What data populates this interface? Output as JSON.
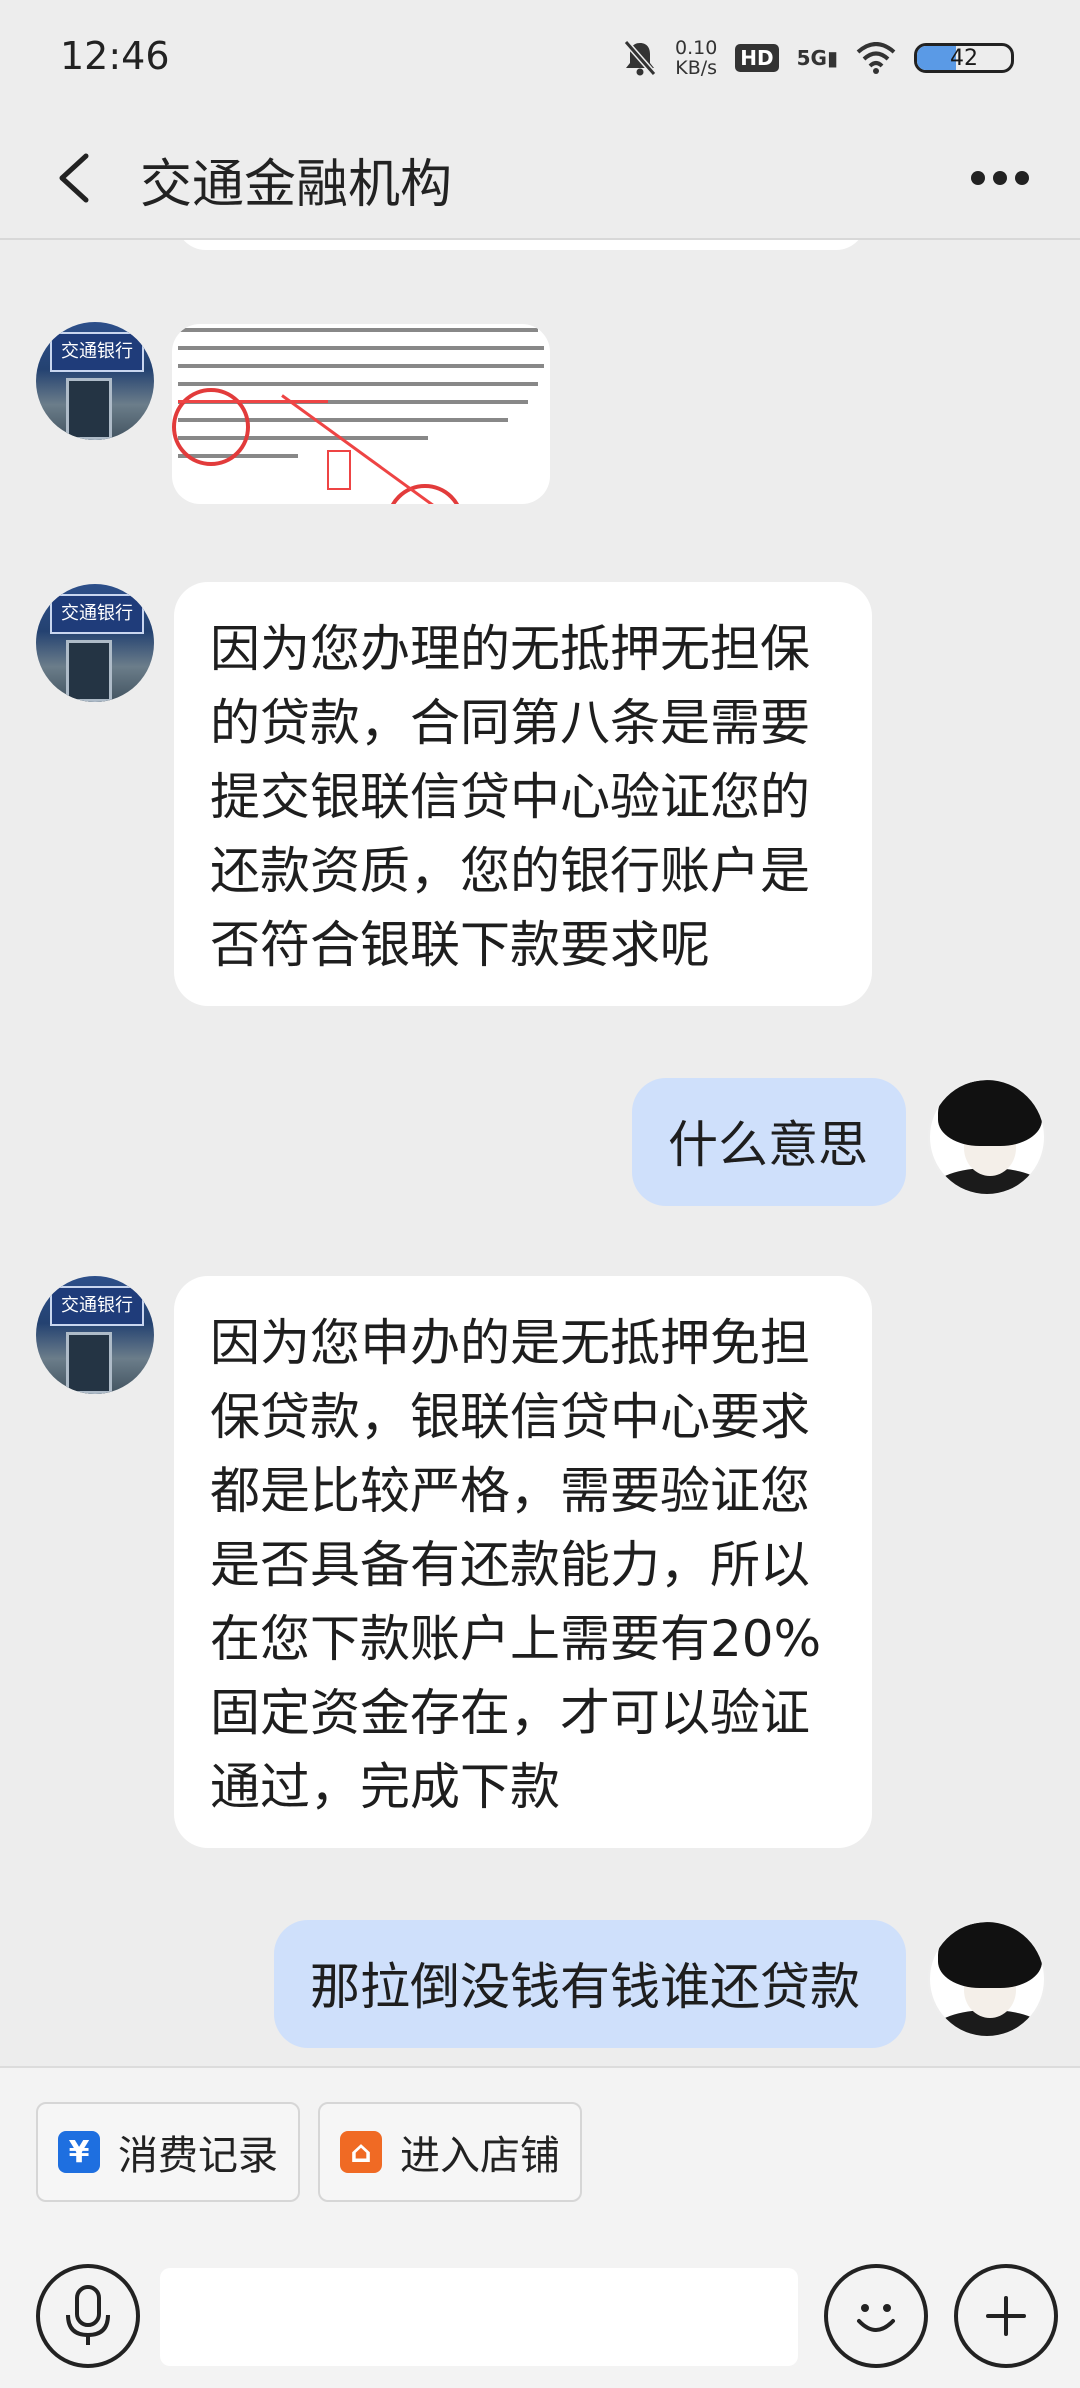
{
  "status": {
    "time": "12:46",
    "net_speed": "0.10",
    "net_unit": "KB/s",
    "hd": "HD",
    "signal": "5G",
    "battery": "42",
    "battery_level": 0.42
  },
  "header": {
    "title": "交通金融机构"
  },
  "avatars": {
    "bank_sign": "交通银行"
  },
  "messages": [
    {
      "side": "in",
      "type": "image"
    },
    {
      "side": "in",
      "text": "因为您办理的无抵押无担保的贷款，合同第八条是需要提交银联信贷中心验证您的还款资质，您的银行账户是否符合银联下款要求呢"
    },
    {
      "side": "out",
      "text": "什么意思"
    },
    {
      "side": "in",
      "text": "因为您申办的是无抵押免担保贷款，银联信贷中心要求都是比较严格，需要验证您是否具备有还款能力，所以在您下款账户上需要有20%固定资金存在，才可以验证通过，完成下款"
    },
    {
      "side": "out",
      "text": "那拉倒没钱有钱谁还贷款"
    }
  ],
  "quick_actions": [
    {
      "label": "消费记录",
      "icon": "yen-icon",
      "glyph": "¥",
      "color": "#1e6fe0"
    },
    {
      "label": "进入店铺",
      "icon": "shop-icon",
      "glyph": "⌂",
      "color": "#f06a24"
    }
  ],
  "input": {
    "placeholder": ""
  }
}
